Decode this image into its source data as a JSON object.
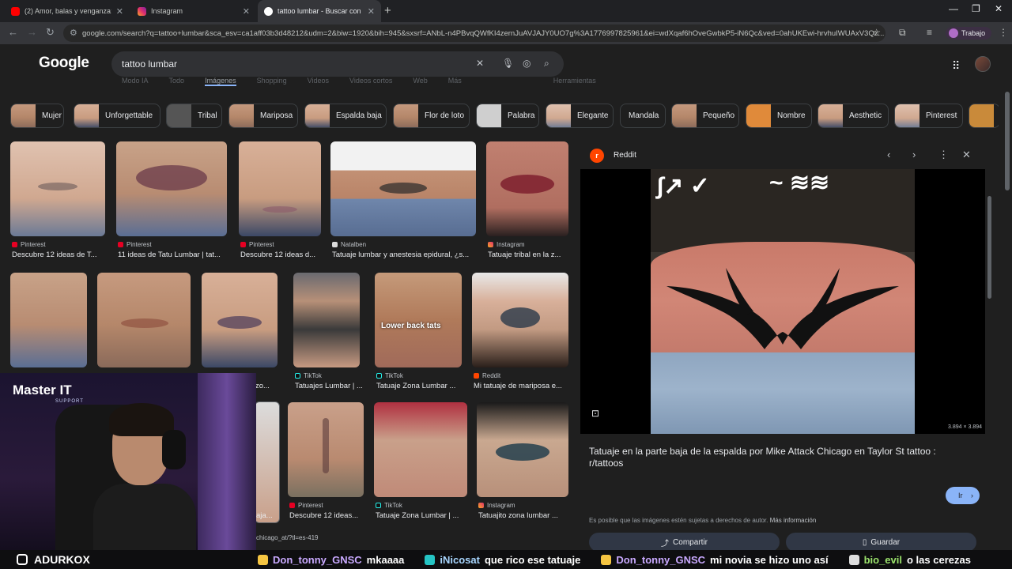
{
  "browser": {
    "tabs": [
      {
        "title": "(2) Amor, balas y venganza: Ro",
        "color": "#ff0000"
      },
      {
        "title": "Instagram",
        "color": "#e1306c"
      },
      {
        "title": "tattoo lumbar - Buscar con Goo",
        "color": "#4285f4"
      }
    ],
    "url": "google.com/search?q=tattoo+lumbar&sca_esv=ca1aff03b3d48212&udm=2&biw=1920&bih=945&sxsrf=ANbL-n4PBvqQWfKI4zernJuAVJAJY0UO7g%3A1776997825961&ei=wdXqaf6hOveGwbkP5-iN6Qc&ved=0ahUKEwi-hrvhuIWUAxV3Qz...",
    "profile": "Trabajo"
  },
  "google": {
    "logo": "Google",
    "query": "tattoo lumbar",
    "ghost_tabs": [
      "Modo IA",
      "Todo",
      "Imágenes",
      "Shopping",
      "Videos",
      "Videos cortos",
      "Web",
      "Más",
      "Herramientas"
    ]
  },
  "chips": [
    "Mujer",
    "Unforgettable",
    "Tribal",
    "Mariposa",
    "Espalda baja",
    "Flor de loto",
    "Palabra",
    "Elegante",
    "Mandala",
    "Pequeño",
    "Nombre",
    "Aesthetic",
    "Pinterest"
  ],
  "results": {
    "row1": [
      {
        "source": "Pinterest",
        "caption": "Descubre 12 ideas de T..."
      },
      {
        "source": "Pinterest",
        "caption": "11 ideas de Tatu Lumbar | tat..."
      },
      {
        "source": "Pinterest",
        "caption": "Descubre 12 ideas d..."
      },
      {
        "source": "Natalben",
        "caption": "Tatuaje lumbar y anestesia epidural, ¿s..."
      },
      {
        "source": "Instagram",
        "caption": "Tatuaje tribal en la z..."
      }
    ],
    "row2": [
      {
        "source": "TikTok",
        "caption": "zo..."
      },
      {
        "source": "TikTok",
        "caption": "Tatuajes Lumbar | ..."
      },
      {
        "source": "TikTok",
        "caption": "Tatuaje Zona Lumbar ...",
        "overlay": "Lower back tats"
      },
      {
        "source": "Reddit",
        "caption": "Mi tatuaje de mariposa e..."
      }
    ],
    "row3": [
      {
        "source": "",
        "caption": "aja..."
      },
      {
        "source": "Pinterest",
        "caption": "Descubre 12 ideas..."
      },
      {
        "source": "TikTok",
        "caption": "Tatuaje Zona Lumbar | ..."
      },
      {
        "source": "Instagram",
        "caption": "Tatuajito zona lumbar ..."
      }
    ],
    "fragment_text": "chicago_at/?tl=es-419"
  },
  "panel": {
    "source": "Reddit",
    "dimensions": "3.894 × 3.894",
    "title": "Tatuaje en la parte baja de la espalda por Mike Attack Chicago en Taylor St tattoo : r/tattoos",
    "go_label": "Ir",
    "copyright": "Es posible que las imágenes estén sujetas a derechos de autor.",
    "more_info": "Más información",
    "share_label": "Compartir",
    "save_label": "Guardar"
  },
  "stream": {
    "logo": "Master IT",
    "logo_sub": "SUPPORT",
    "streamer": "ADURKOX",
    "chat": [
      {
        "user": "Don_tonny_GNSC",
        "message": "mkaaaa"
      },
      {
        "user": "iNicosat",
        "message": "que rico ese tatuaje"
      },
      {
        "user": "Don_tonny_GNSC",
        "message": "mi novia se hizo uno así"
      },
      {
        "user": "bio_evil",
        "message": "o las cerezas"
      }
    ]
  },
  "colors": {
    "accent": "#8ab4f8",
    "reddit": "#ff4500",
    "background": "#1f1f1f"
  }
}
